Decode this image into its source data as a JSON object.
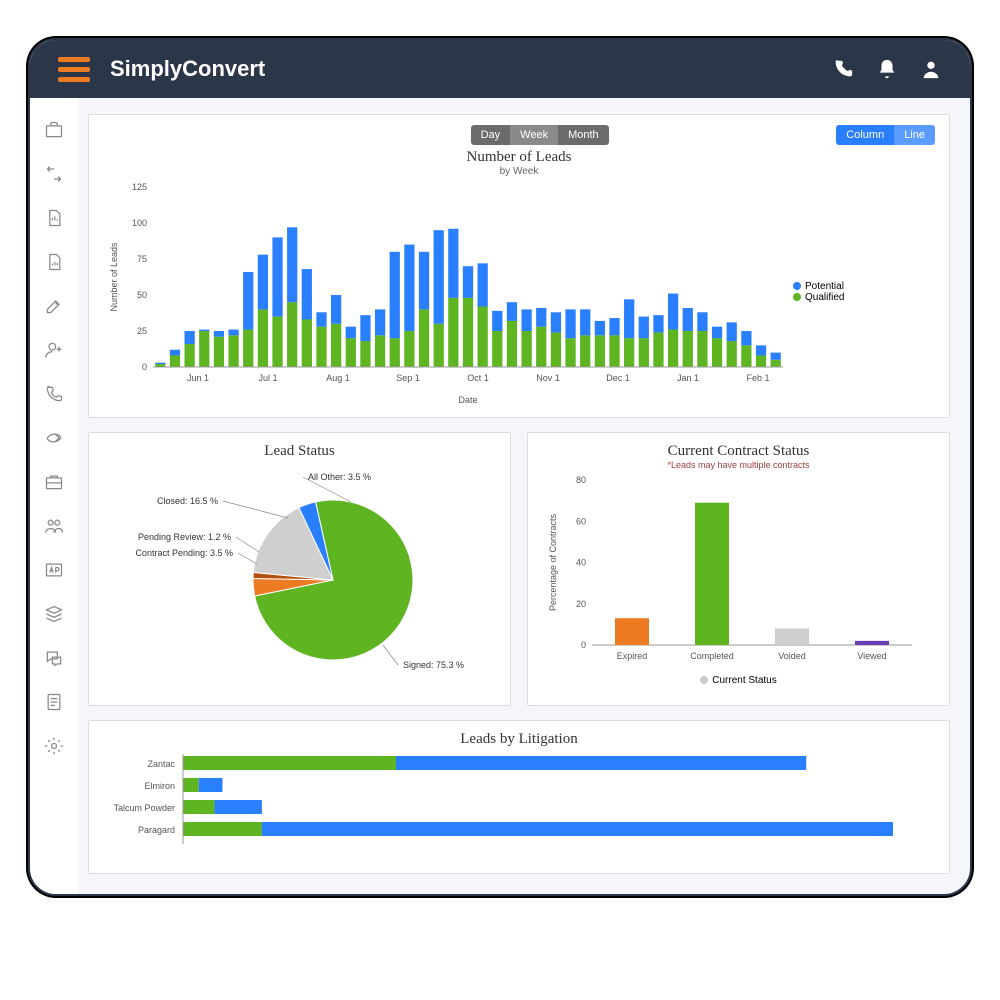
{
  "header": {
    "app_title": "SimplyConvert"
  },
  "toggles": {
    "period": {
      "day": "Day",
      "week": "Week",
      "month": "Month"
    },
    "chart_type": {
      "column": "Column",
      "line": "Line"
    }
  },
  "leads_chart": {
    "title": "Number of Leads",
    "subtitle": "by Week",
    "ylabel": "Number of Leads",
    "xlabel": "Date",
    "legend": {
      "potential": "Potential",
      "qualified": "Qualified"
    }
  },
  "lead_status": {
    "title": "Lead Status",
    "labels": {
      "all_other": "All Other: 3.5 %",
      "closed": "Closed: 16.5 %",
      "pending_review": "Pending Review: 1.2 %",
      "contract_pending": "Contract Pending: 3.5 %",
      "signed": "Signed: 75.3 %"
    }
  },
  "contract_status": {
    "title": "Current Contract Status",
    "footnote": "*Leads may have multiple contracts",
    "ylabel": "Percentage of Contracts",
    "legend": "Current Status",
    "categories": {
      "expired": "Expired",
      "completed": "Completed",
      "voided": "Voided",
      "viewed": "Viewed"
    }
  },
  "litigation": {
    "title": "Leads by Litigation",
    "categories": {
      "zantac": "Zantac",
      "elmiron": "Elmiron",
      "talcum": "Talcum Powder",
      "paragard": "Paragard"
    }
  },
  "chart_data": [
    {
      "id": "number_of_leads",
      "type": "bar",
      "stacked": true,
      "title": "Number of Leads",
      "subtitle": "by Week",
      "xlabel": "Date",
      "ylabel": "Number of Leads",
      "ylim": [
        0,
        125
      ],
      "x_ticks": [
        "Jun 1",
        "Jul 1",
        "Aug 1",
        "Sep 1",
        "Oct 1",
        "Nov 1",
        "Dec 1",
        "Jan 1",
        "Feb 1"
      ],
      "series": [
        {
          "name": "Qualified",
          "color": "#5fb422",
          "values": [
            2,
            8,
            16,
            25,
            21,
            22,
            26,
            40,
            35,
            45,
            33,
            28,
            30,
            20,
            18,
            22,
            20,
            25,
            40,
            30,
            48,
            48,
            42,
            25,
            32,
            25,
            28,
            24,
            20,
            22,
            22,
            22,
            20,
            20,
            24,
            26,
            25,
            25,
            20,
            18,
            15,
            8,
            5
          ]
        },
        {
          "name": "Potential",
          "color": "#2a7fff",
          "values": [
            1,
            4,
            9,
            1,
            4,
            4,
            40,
            38,
            55,
            52,
            35,
            10,
            20,
            8,
            18,
            18,
            60,
            60,
            40,
            65,
            48,
            22,
            30,
            14,
            13,
            15,
            13,
            14,
            20,
            18,
            10,
            12,
            27,
            15,
            12,
            25,
            16,
            13,
            8,
            13,
            10,
            7,
            5
          ]
        }
      ]
    },
    {
      "id": "lead_status",
      "type": "pie",
      "title": "Lead Status",
      "slices": [
        {
          "name": "Signed",
          "value": 75.3,
          "color": "#5fb422"
        },
        {
          "name": "Closed",
          "value": 16.5,
          "color": "#cfcfcf"
        },
        {
          "name": "All Other",
          "value": 3.5,
          "color": "#2a7fff"
        },
        {
          "name": "Contract Pending",
          "value": 3.5,
          "color": "#ed7b21"
        },
        {
          "name": "Pending Review",
          "value": 1.2,
          "color": "#b55010"
        }
      ]
    },
    {
      "id": "current_contract_status",
      "type": "bar",
      "title": "Current Contract Status",
      "ylabel": "Percentage of Contracts",
      "ylim": [
        0,
        80
      ],
      "categories": [
        "Expired",
        "Completed",
        "Voided",
        "Viewed"
      ],
      "values": [
        13,
        69,
        8,
        2
      ],
      "colors": [
        "#ed7b21",
        "#5fb422",
        "#cfcfcf",
        "#6a3fb5"
      ]
    },
    {
      "id": "leads_by_litigation",
      "type": "bar",
      "orientation": "horizontal",
      "stacked": true,
      "title": "Leads by Litigation",
      "categories": [
        "Zantac",
        "Elmiron",
        "Talcum Powder",
        "Paragard"
      ],
      "series": [
        {
          "name": "Qualified",
          "color": "#5fb422",
          "values": [
            27,
            2,
            4,
            10
          ]
        },
        {
          "name": "Potential",
          "color": "#2a7fff",
          "values": [
            52,
            3,
            6,
            80
          ]
        }
      ]
    }
  ]
}
